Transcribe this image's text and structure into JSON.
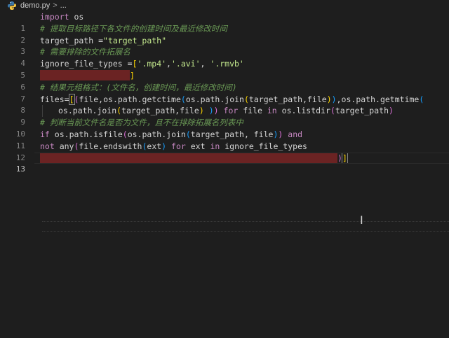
{
  "tab": {
    "filename": "demo.py",
    "separator": ">",
    "breadcrumb_rest": "...",
    "icon": "python-icon"
  },
  "line_numbers": [
    "1",
    "2",
    "3",
    "4",
    "5",
    "6",
    "7",
    "8",
    "9",
    "10",
    "11",
    "12",
    "13"
  ],
  "code": {
    "l1_import": "import",
    "l1_os": "os",
    "l2_comment": "# 提取目标路径下各文件的创建时间及最近修改时间",
    "l3_var": "target_path",
    "l3_eq": " =",
    "l3_str": "\"target_path\"",
    "l4_comment": "# 需要排除的文件拓展名",
    "l5_var": "ignore_file_types",
    "l5_eq": " =",
    "l5_open": "[",
    "l5_s1": "'.mp4'",
    "l5_c1": ",",
    "l5_s2": "'.avi'",
    "l5_c2": ", ",
    "l5_s3": "'.rmvb'",
    "l6_close": "]",
    "l7_comment": "# 结果元组格式：(文件名，创建时间，最近修改时间)",
    "l8_var": "files",
    "l8_eq": "=",
    "l8_lb": "[",
    "l8_lp": "(",
    "l8_file": "file",
    "l8_comma": ",",
    "l8_os1": "os",
    "l8_dot1": ".",
    "l8_path1": "path",
    "l8_dot2": ".",
    "l8_getctime": "getctime",
    "l8_p1": "(",
    "l8_os2": "os",
    "l8_dot3": ".",
    "l8_path2": "path",
    "l8_dot4": ".",
    "l8_join": "join",
    "l8_p2": "(",
    "l8_args": "target_path,file",
    "l8_p3": ")",
    "l8_p4": ")",
    "l8_comma2": ",",
    "l8_os3": "os",
    "l8_dot5": ".",
    "l8_path3": "path",
    "l8_dot6": ".",
    "l8_getmtime": "getmtime",
    "l8_p5": "(",
    "l9_os": "os",
    "l9_dot1": ".",
    "l9_path": "path",
    "l9_dot2": ".",
    "l9_join": "join",
    "l9_p1": "(",
    "l9_args": "target_path,file",
    "l9_p2": ")",
    "l9_sp": " ",
    "l9_p3": ")",
    "l9_p4": ")",
    "l9_for": " for ",
    "l9_file": "file",
    "l9_in": " in ",
    "l9_os2": "os",
    "l9_dot3": ".",
    "l9_listdir": "listdir",
    "l9_p5": "(",
    "l9_tp": "target_path",
    "l9_p6": ")",
    "l10_comment": "# 判断当前文件名是否为文件，且不在排除拓展名列表中",
    "l11_if": "if",
    "l11_os": " os",
    "l11_dot1": ".",
    "l11_path": "path",
    "l11_dot2": ".",
    "l11_isfile": "isfile",
    "l11_p1": "(",
    "l11_os2": "os",
    "l11_dot3": ".",
    "l11_path2": "path",
    "l11_dot4": ".",
    "l11_join": "join",
    "l11_p2": "(",
    "l11_args": "target_path, file",
    "l11_p3": ")",
    "l11_p4": ")",
    "l11_and": " and",
    "l12_not": "not",
    "l12_any": " any",
    "l12_p1": "(",
    "l12_file": "file",
    "l12_dot": ".",
    "l12_endswith": "endswith",
    "l12_p2": "(",
    "l12_ext": "ext",
    "l12_p3": ")",
    "l12_for": " for ",
    "l12_ext2": "ext",
    "l12_in": " in ",
    "l12_ift": "ignore_file_types",
    "l13_p": ")",
    "l13_b": "]"
  }
}
